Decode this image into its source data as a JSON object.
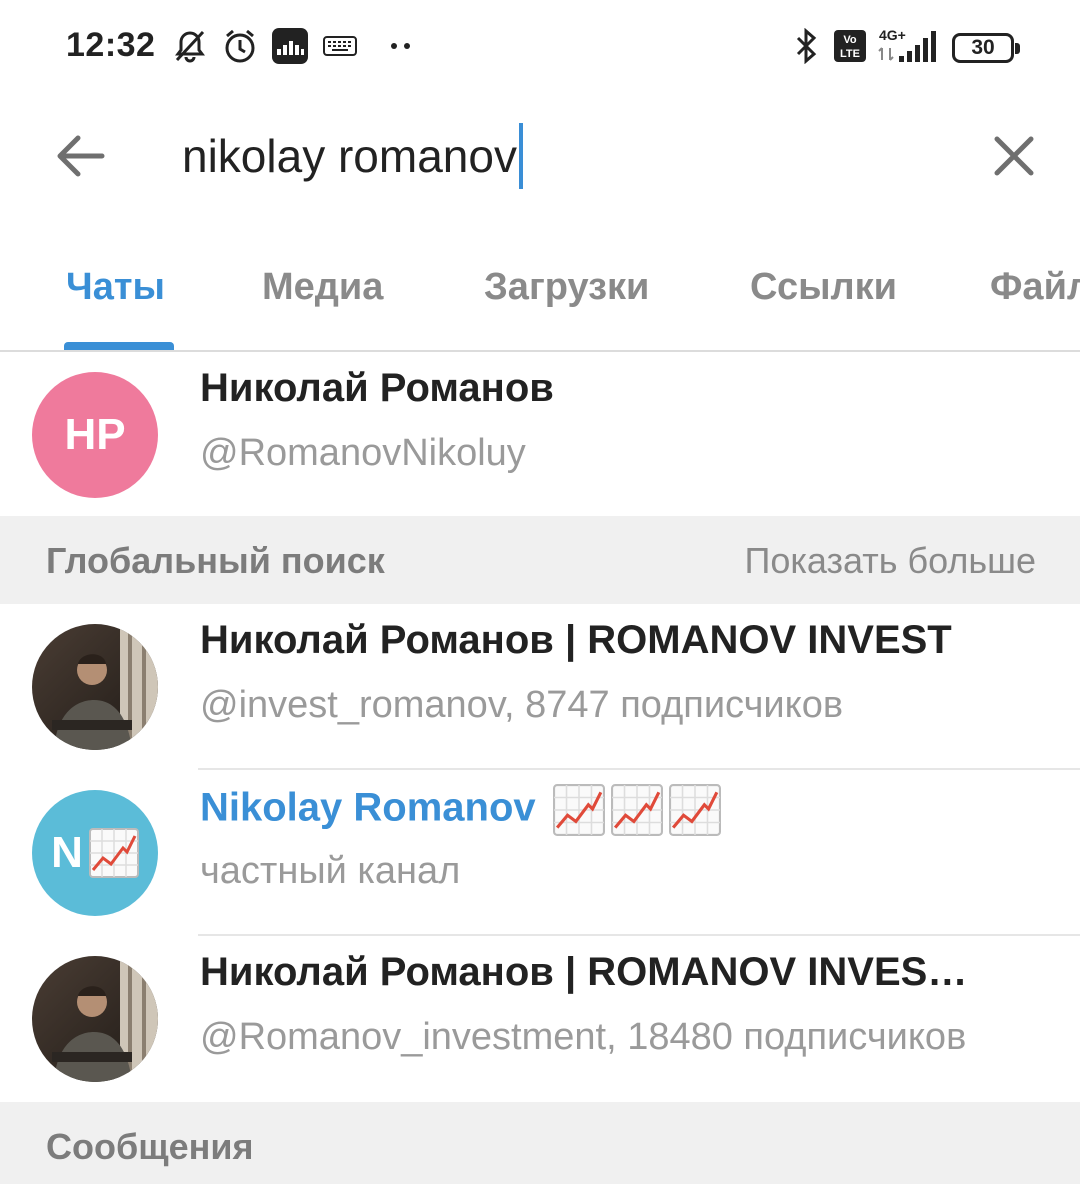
{
  "status_bar": {
    "time": "12:32",
    "icons": [
      "mute-icon",
      "alarm-icon",
      "audio-app-icon",
      "keyboard-icon",
      "more-dots-icon",
      "bluetooth-icon",
      "volte-icon",
      "signal-4g-icon"
    ],
    "network_label": "4G+",
    "volte_label": "Vo LTE",
    "battery": "30"
  },
  "search": {
    "query": "nikolay romanov",
    "back_icon": "arrow-left-icon",
    "clear_icon": "close-icon",
    "accent": "#3a8fd6"
  },
  "tabs": [
    {
      "label": "Чаты",
      "active": true
    },
    {
      "label": "Медиа",
      "active": false
    },
    {
      "label": "Загрузки",
      "active": false
    },
    {
      "label": "Ссылки",
      "active": false
    },
    {
      "label": "Файлы",
      "active": false
    }
  ],
  "local_results": [
    {
      "initials": "НР",
      "avatar_color": "#ef7a9c",
      "title": "Николай Романов",
      "subtitle": "@RomanovNikoluy"
    }
  ],
  "global_section": {
    "title": "Глобальный поиск",
    "action": "Показать больше"
  },
  "global_results": [
    {
      "avatar": "photo",
      "title": "Николай Романов | ROMANOV INVEST",
      "subtitle": "@invest_romanov, 8747 подписчиков"
    },
    {
      "avatar": "letter",
      "initials": "N",
      "avatar_color": "#5bbcd8",
      "title": "Nikolay Romanov",
      "title_emoji": "chart-increasing-icon ×3",
      "subtitle": "частный канал"
    },
    {
      "avatar": "photo",
      "title": "Николай Романов | ROMANOV INVESTMENT",
      "subtitle": "@Romanov_investment, 18480 подписчиков"
    }
  ],
  "messages_section": {
    "title": "Сообщения"
  }
}
